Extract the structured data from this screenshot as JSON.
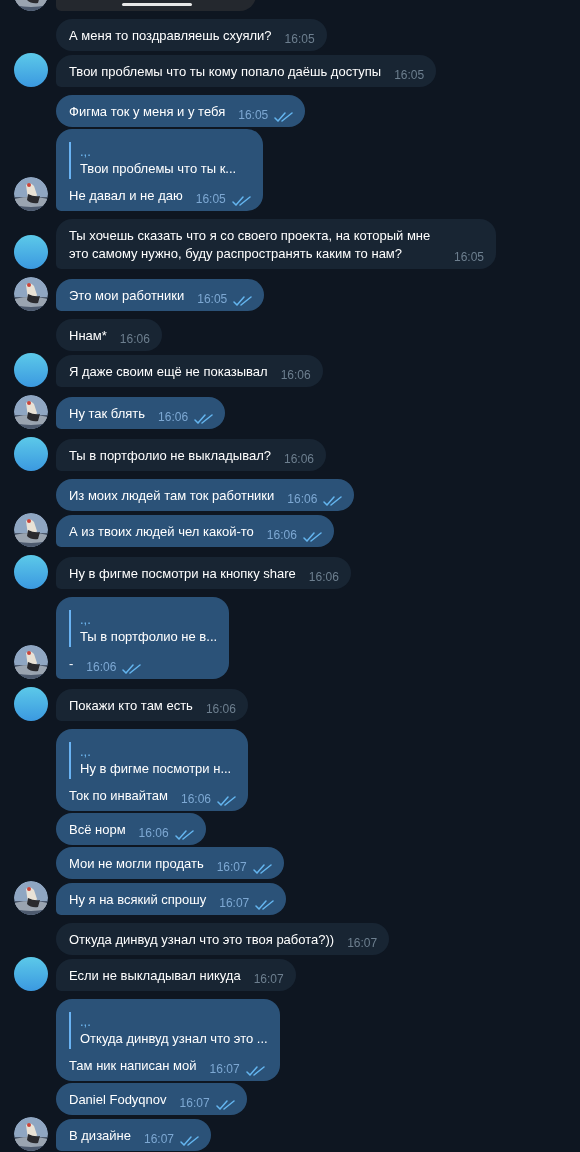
{
  "messages": [
    {
      "kind": "media",
      "outgoing": true,
      "avatar": true
    },
    {
      "kind": "text",
      "outgoing": false,
      "avatar": false,
      "text": "А меня то поздравляешь схуяли?",
      "time": "16:05"
    },
    {
      "kind": "text",
      "outgoing": false,
      "avatar": true,
      "text": "Твои проблемы что ты кому попало даёшь доступы",
      "time": "16:05"
    },
    {
      "kind": "text",
      "outgoing": true,
      "avatar": false,
      "read": true,
      "text": "Фигма ток у меня и у тебя",
      "time": "16:05"
    },
    {
      "kind": "reply",
      "outgoing": true,
      "avatar": true,
      "read": true,
      "reply": {
        "name": ".,.",
        "text": "Твои проблемы что ты к..."
      },
      "text": "Не давал и не даю",
      "time": "16:05"
    },
    {
      "kind": "text",
      "outgoing": false,
      "avatar": true,
      "text": "Ты хочешь сказать что я со своего проекта, на который мне это самому нужно, буду распространять каким то нам?",
      "time": "16:05"
    },
    {
      "kind": "text",
      "outgoing": true,
      "avatar": true,
      "read": true,
      "text": "Это мои работники",
      "time": "16:05"
    },
    {
      "kind": "text",
      "outgoing": false,
      "avatar": false,
      "text": "Ннам*",
      "time": "16:06"
    },
    {
      "kind": "text",
      "outgoing": false,
      "avatar": true,
      "text": "Я даже своим ещё не показывал",
      "time": "16:06"
    },
    {
      "kind": "text",
      "outgoing": true,
      "avatar": true,
      "read": true,
      "text": "Ну так блять",
      "time": "16:06"
    },
    {
      "kind": "text",
      "outgoing": false,
      "avatar": true,
      "text": "Ты в портфолио не выкладывал?",
      "time": "16:06"
    },
    {
      "kind": "text",
      "outgoing": true,
      "avatar": false,
      "read": true,
      "text": "Из моих людей там ток работники",
      "time": "16:06"
    },
    {
      "kind": "text",
      "outgoing": true,
      "avatar": true,
      "read": true,
      "text": "А из твоих людей чел какой-то",
      "time": "16:06"
    },
    {
      "kind": "text",
      "outgoing": false,
      "avatar": true,
      "text": "Ну в фигме посмотри на кнопку share",
      "time": "16:06"
    },
    {
      "kind": "reply",
      "outgoing": true,
      "avatar": true,
      "read": true,
      "reply": {
        "name": ".,.",
        "text": "Ты в портфолио не в..."
      },
      "text": "-",
      "time": "16:06"
    },
    {
      "kind": "text",
      "outgoing": false,
      "avatar": true,
      "text": "Покажи кто там есть",
      "time": "16:06"
    },
    {
      "kind": "reply",
      "outgoing": true,
      "avatar": false,
      "read": true,
      "reply": {
        "name": ".,.",
        "text": "Ну в фигме посмотри н..."
      },
      "text": "Ток по инвайтам",
      "time": "16:06"
    },
    {
      "kind": "text",
      "outgoing": true,
      "avatar": false,
      "read": true,
      "text": "Всё норм",
      "time": "16:06"
    },
    {
      "kind": "text",
      "outgoing": true,
      "avatar": false,
      "read": true,
      "text": "Мои не могли продать",
      "time": "16:07"
    },
    {
      "kind": "text",
      "outgoing": true,
      "avatar": true,
      "read": true,
      "text": "Ну я на всякий спрошу",
      "time": "16:07"
    },
    {
      "kind": "text",
      "outgoing": false,
      "avatar": false,
      "text": "Откуда динвуд узнал что это твоя работа?))",
      "time": "16:07"
    },
    {
      "kind": "text",
      "outgoing": false,
      "avatar": true,
      "text": "Если не выкладывал никуда",
      "time": "16:07"
    },
    {
      "kind": "reply",
      "outgoing": true,
      "avatar": false,
      "read": true,
      "reply": {
        "name": ".,.",
        "text": "Откуда динвуд узнал что это ..."
      },
      "text": "Там ник написан мой",
      "time": "16:07"
    },
    {
      "kind": "text",
      "outgoing": true,
      "avatar": false,
      "read": true,
      "text": "Daniel Fodyqnov",
      "time": "16:07"
    },
    {
      "kind": "text",
      "outgoing": true,
      "avatar": true,
      "read": true,
      "text": "В дизайне",
      "time": "16:07"
    }
  ]
}
